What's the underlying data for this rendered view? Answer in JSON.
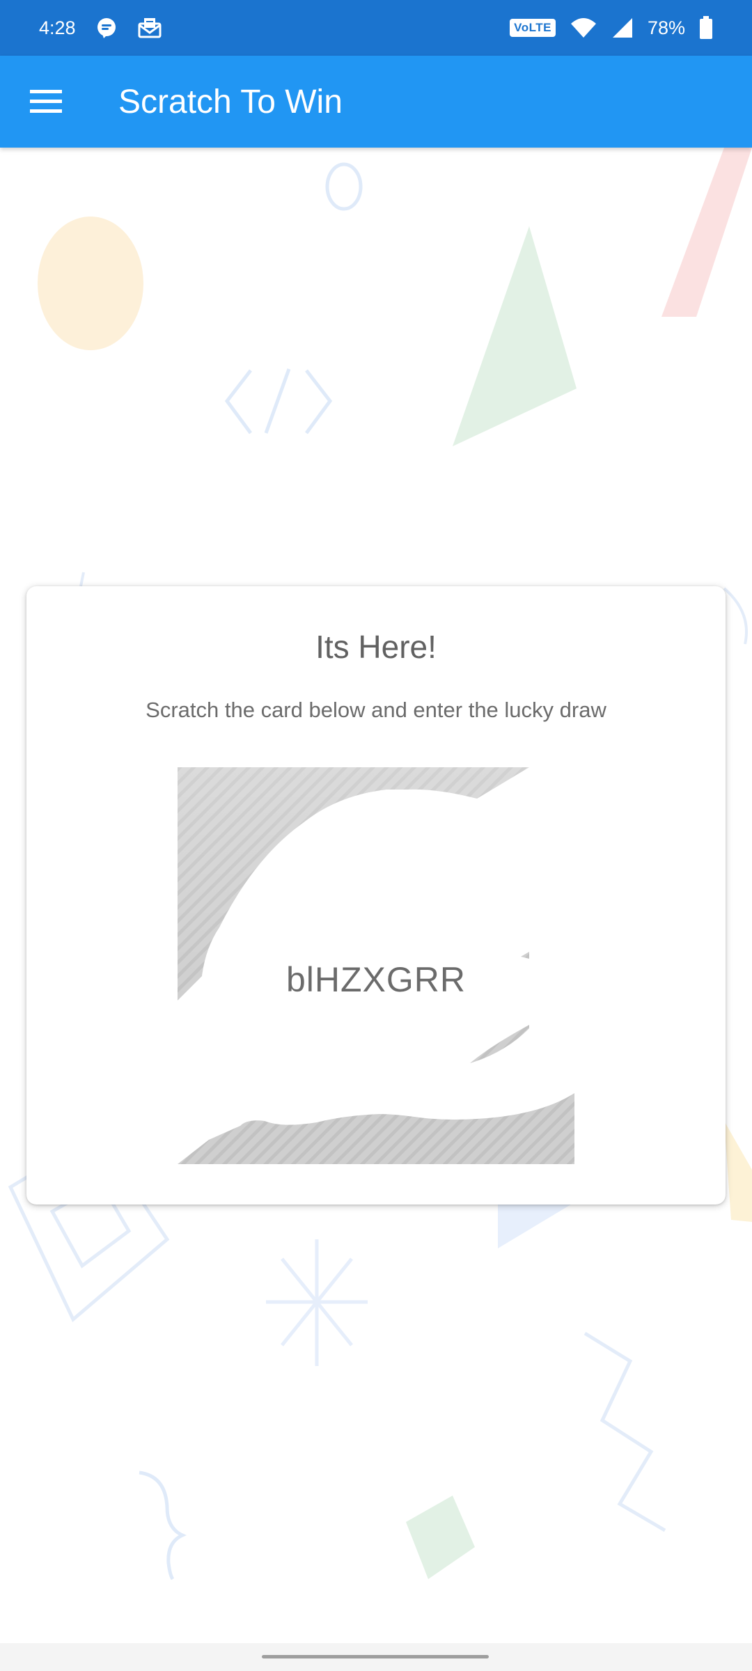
{
  "status_bar": {
    "time": "4:28",
    "network_badge": "VoLTE",
    "battery_percent": "78%",
    "icons": [
      "message-notification-icon",
      "mail-notification-icon",
      "wifi-icon",
      "signal-icon",
      "battery-icon"
    ]
  },
  "app_bar": {
    "menu_icon": "hamburger-menu-icon",
    "title": "Scratch To Win"
  },
  "card": {
    "title": "Its Here!",
    "subtitle": "Scratch the card below and enter the lucky draw",
    "coupon_code": "blHZXGRR"
  },
  "colors": {
    "status_bar": "#1b74cf",
    "app_bar": "#2196f3",
    "text": "#616161",
    "scratch_gray": "#cccccc"
  }
}
